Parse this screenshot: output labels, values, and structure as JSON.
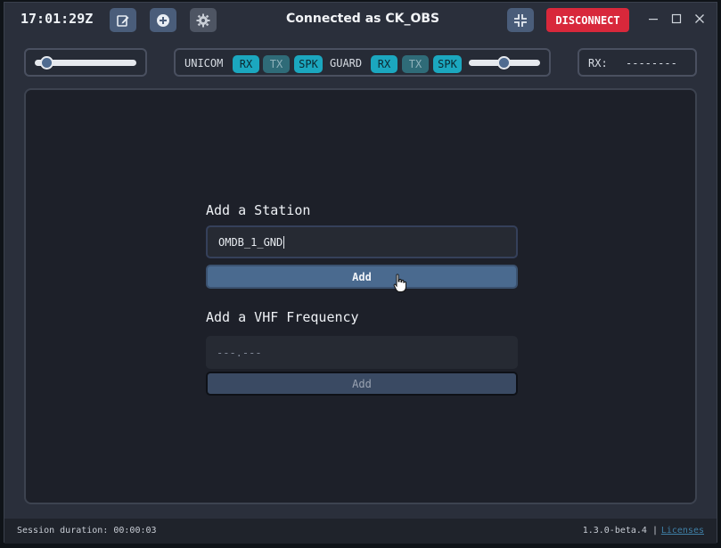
{
  "titlebar": {
    "clock": "17:01:29Z",
    "connection_text": "Connected as CK_OBS",
    "disconnect_label": "DISCONNECT",
    "icons": [
      "edit-icon",
      "add-circle-icon",
      "gear-icon",
      "compress-icon",
      "minimize-icon",
      "maximize-icon",
      "close-icon"
    ]
  },
  "controls": {
    "left_volume": 0.1,
    "unicom_label": "UNICOM",
    "guard_label": "GUARD",
    "unicom": {
      "rx": "RX",
      "tx": "TX",
      "spk": "SPK"
    },
    "guard": {
      "rx": "RX",
      "tx": "TX",
      "spk": "SPK"
    },
    "guard_volume": 0.5,
    "rx_label": "RX:",
    "rx_value": "--------"
  },
  "station": {
    "title": "Add a Station",
    "value": "OMDB_1_GND",
    "add_label": "Add"
  },
  "vhf": {
    "title": "Add a VHF Frequency",
    "placeholder": "---.---",
    "add_label": "Add"
  },
  "status": {
    "session": "Session duration: 00:00:03",
    "version": "1.3.0-beta.4 |",
    "licenses": "Licenses"
  },
  "colors": {
    "disconnect": "#d8283b",
    "pill_active": "#1ba7bf",
    "accent_button": "#4a6a8f"
  }
}
